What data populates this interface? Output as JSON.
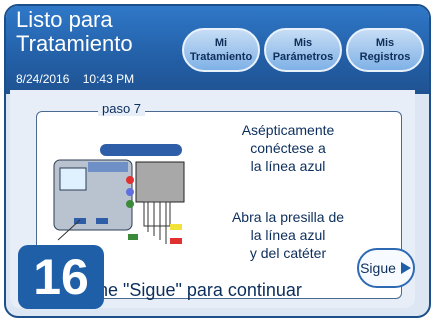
{
  "header": {
    "title_line1": "Listo para",
    "title_line2": "Tratamiento",
    "date": "8/24/2016",
    "time": "10:43 PM"
  },
  "nav": [
    {
      "line1": "Mi",
      "line2": "Tratamiento"
    },
    {
      "line1": "Mis",
      "line2": "Parámetros"
    },
    {
      "line1": "Mis",
      "line2": "Registros"
    }
  ],
  "step": {
    "label": "paso 7",
    "badge": "16",
    "instruction1": [
      "Asépticamente",
      "conéctese a",
      "la línea azul"
    ],
    "instruction2": [
      "Abra la presilla de",
      "la línea azul",
      "y del catéter"
    ],
    "bottom": "one \"Sigue\" para continuar"
  },
  "next_button": {
    "label": "Sigue",
    "icon": "play-right-icon"
  },
  "colors": {
    "header": "#235fa6",
    "accent": "#1f5fa8"
  }
}
